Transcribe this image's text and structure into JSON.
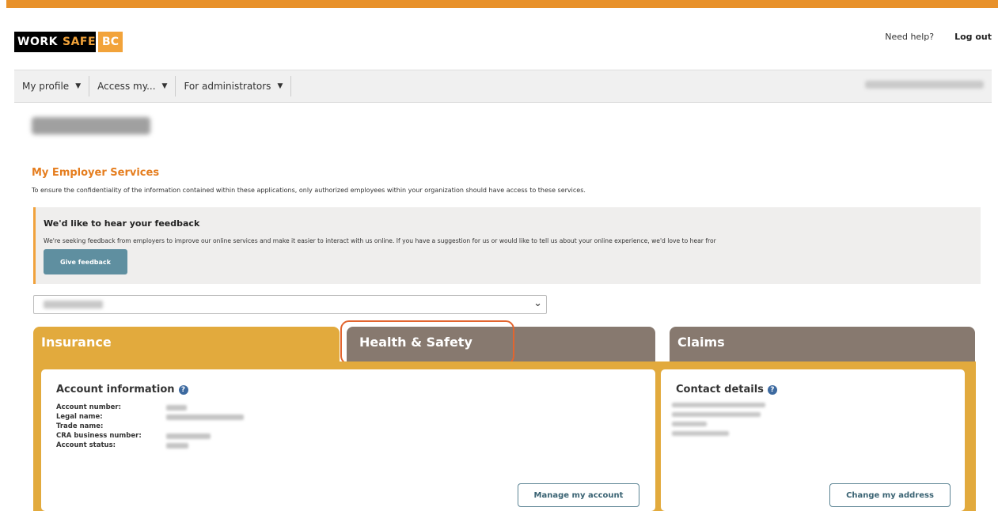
{
  "header": {
    "logo": {
      "part1": "WORK",
      "part2": "SAFE",
      "part3": "BC"
    },
    "need_help": "Need help?",
    "log_out": "Log out"
  },
  "nav": {
    "items": [
      {
        "label": "My profile"
      },
      {
        "label": "Access my..."
      },
      {
        "label": "For administrators"
      }
    ]
  },
  "services": {
    "title": "My Employer Services",
    "description": "To ensure the confidentiality of the information contained within these applications, only authorized employees within your organization should have access to these services."
  },
  "feedback": {
    "title": "We'd like to hear your feedback",
    "text": "We're seeking feedback from employers to improve our online services and make it easier to interact with us online. If you have a suggestion for us or would like to tell us about your online experience, we'd love to hear fror",
    "button": "Give feedback"
  },
  "tabs": [
    {
      "label": "Insurance"
    },
    {
      "label": "Health & Safety"
    },
    {
      "label": "Claims"
    }
  ],
  "account_info": {
    "title": "Account information",
    "rows": [
      {
        "label": "Account number:"
      },
      {
        "label": "Legal name:"
      },
      {
        "label": "Trade name:"
      },
      {
        "label": "CRA business number:"
      },
      {
        "label": "Account status:"
      }
    ],
    "button": "Manage my account"
  },
  "contact": {
    "title": "Contact details",
    "button": "Change my address"
  },
  "colors": {
    "accent_orange": "#e8912a",
    "insurance_tab": "#e2aa3d",
    "inactive_tab": "#87796f",
    "highlight_outline": "#e2652f",
    "feedback_button": "#5f8fa0"
  },
  "icons": {
    "help": "question-circle-icon",
    "caret": "caret-down-icon"
  }
}
